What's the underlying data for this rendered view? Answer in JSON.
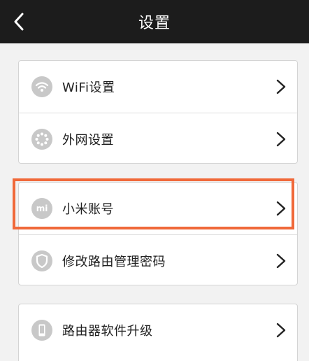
{
  "topbar": {
    "title": "设置"
  },
  "groups": [
    {
      "items": [
        {
          "label": "WiFi设置",
          "icon": "wifi-icon"
        },
        {
          "label": "外网设置",
          "icon": "network-ring-icon"
        }
      ]
    },
    {
      "items": [
        {
          "label": "小米账号",
          "icon": "mi-logo-icon",
          "mi_text": "mi"
        },
        {
          "label": "修改路由管理密码",
          "icon": "shield-icon"
        }
      ]
    },
    {
      "items": [
        {
          "label": "路由器软件升级",
          "icon": "phone-icon"
        }
      ]
    }
  ],
  "colors": {
    "topbar_bg": "#1c1c1c",
    "highlight": "#f0693a",
    "icon_bg": "#c8c8c8",
    "page_bg": "#f2f2f2"
  }
}
